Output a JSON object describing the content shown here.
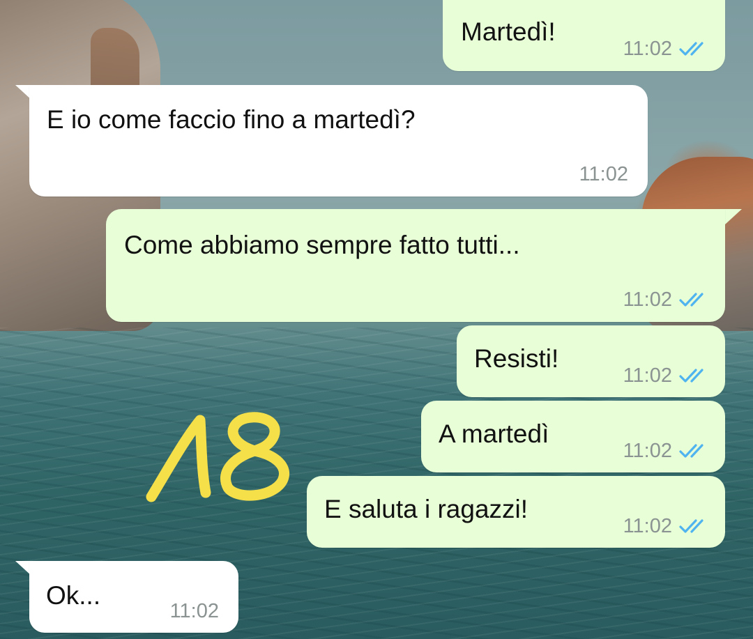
{
  "chat": {
    "messages": [
      {
        "id": "m1",
        "direction": "outgoing",
        "text": "Martedì!",
        "time": "11:02",
        "status": "read"
      },
      {
        "id": "m2",
        "direction": "incoming",
        "text": "E io come faccio fino a martedì?",
        "time": "11:02"
      },
      {
        "id": "m3",
        "direction": "outgoing",
        "text": "Come abbiamo sempre fatto tutti...",
        "time": "11:02",
        "status": "read"
      },
      {
        "id": "m4",
        "direction": "outgoing",
        "text": "Resisti!",
        "time": "11:02",
        "status": "read"
      },
      {
        "id": "m5",
        "direction": "outgoing",
        "text": "A martedì",
        "time": "11:02",
        "status": "read"
      },
      {
        "id": "m6",
        "direction": "outgoing",
        "text": "E saluta i ragazzi!",
        "time": "11:02",
        "status": "read"
      },
      {
        "id": "m7",
        "direction": "incoming",
        "text": "Ok...",
        "time": "11:02"
      }
    ]
  },
  "overlay": {
    "number": "18",
    "color": "#f6e04a"
  },
  "colors": {
    "outgoing_bubble": "#e7fed7",
    "incoming_bubble": "#ffffff",
    "read_ticks": "#4fb3ef",
    "timestamp": "#8a9391"
  },
  "icons": {
    "read_receipt": "double-check-icon"
  }
}
